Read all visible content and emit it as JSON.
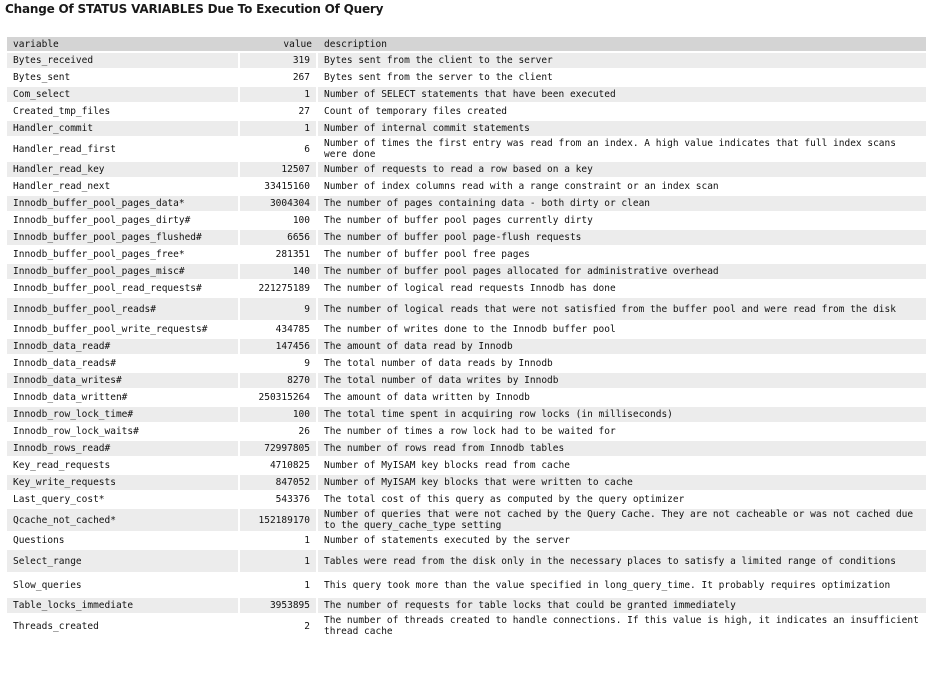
{
  "title": "Change Of STATUS VARIABLES Due To Execution Of Query",
  "columns": {
    "variable": "variable",
    "value": "value",
    "description": "description"
  },
  "rows": [
    {
      "variable": "Bytes_received",
      "value": "319",
      "description": "Bytes sent from the client to the server"
    },
    {
      "variable": "Bytes_sent",
      "value": "267",
      "description": "Bytes sent from the server to the client"
    },
    {
      "variable": "Com_select",
      "value": "1",
      "description": "Number of SELECT statements that have been executed"
    },
    {
      "variable": "Created_tmp_files",
      "value": "27",
      "description": "Count of temporary files created"
    },
    {
      "variable": "Handler_commit",
      "value": "1",
      "description": "Number of internal commit statements"
    },
    {
      "variable": "Handler_read_first",
      "value": "6",
      "description": "Number of times the first entry was read from an index. A high value indicates that full index scans were done"
    },
    {
      "variable": "Handler_read_key",
      "value": "12507",
      "description": "Number of requests to read a row based on a key"
    },
    {
      "variable": "Handler_read_next",
      "value": "33415160",
      "description": "Number of index columns read with a range constraint or an index scan"
    },
    {
      "variable": "Innodb_buffer_pool_pages_data*",
      "value": "3004304",
      "description": "The number of pages containing data - both dirty or clean"
    },
    {
      "variable": "Innodb_buffer_pool_pages_dirty#",
      "value": "100",
      "description": "The number of buffer pool pages currently dirty"
    },
    {
      "variable": "Innodb_buffer_pool_pages_flushed#",
      "value": "6656",
      "description": "The number of buffer pool page-flush requests"
    },
    {
      "variable": "Innodb_buffer_pool_pages_free*",
      "value": "281351",
      "description": "The number of buffer pool free pages"
    },
    {
      "variable": "Innodb_buffer_pool_pages_misc#",
      "value": "140",
      "description": "The number of buffer pool pages allocated for administrative overhead"
    },
    {
      "variable": "Innodb_buffer_pool_read_requests#",
      "value": "221275189",
      "description": "The number of logical read requests Innodb has done"
    },
    {
      "variable": "Innodb_buffer_pool_reads#",
      "value": "9",
      "description": "The number of logical reads that were not satisfied from the buffer pool and were read from the disk"
    },
    {
      "variable": "Innodb_buffer_pool_write_requests#",
      "value": "434785",
      "description": "The number of writes done to the Innodb buffer pool"
    },
    {
      "variable": "Innodb_data_read#",
      "value": "147456",
      "description": "The amount of data read by Innodb"
    },
    {
      "variable": "Innodb_data_reads#",
      "value": "9",
      "description": "The total number of data reads by Innodb"
    },
    {
      "variable": "Innodb_data_writes#",
      "value": "8270",
      "description": "The total number of data writes by Innodb"
    },
    {
      "variable": "Innodb_data_written#",
      "value": "250315264",
      "description": "The amount of data written by Innodb"
    },
    {
      "variable": "Innodb_row_lock_time#",
      "value": "100",
      "description": "The total time spent in acquiring row locks (in milliseconds)"
    },
    {
      "variable": "Innodb_row_lock_waits#",
      "value": "26",
      "description": "The number of times a row lock had to be waited for"
    },
    {
      "variable": "Innodb_rows_read#",
      "value": "72997805",
      "description": "The number of rows read from Innodb tables"
    },
    {
      "variable": "Key_read_requests",
      "value": "4710825",
      "description": "Number of MyISAM key blocks read from cache"
    },
    {
      "variable": "Key_write_requests",
      "value": "847052",
      "description": "Number of MyISAM key blocks that were written to cache"
    },
    {
      "variable": "Last_query_cost*",
      "value": "543376",
      "description": "The total cost of this query as computed by the query optimizer"
    },
    {
      "variable": "Qcache_not_cached*",
      "value": "152189170",
      "description": "Number of queries that were not cached by the Query Cache. They are not cacheable or was not cached due to the query_cache_type setting"
    },
    {
      "variable": "Questions",
      "value": "1",
      "description": "Number of statements executed by the server"
    },
    {
      "variable": "Select_range",
      "value": "1",
      "description": "Tables were read from the disk only in the necessary places to satisfy a limited range of conditions"
    },
    {
      "variable": "Slow_queries",
      "value": "1",
      "description": "This query took more than the value specified in long_query_time. It probably requires optimization"
    },
    {
      "variable": "Table_locks_immediate",
      "value": "3953895",
      "description": "The number of requests for table locks that could be granted immediately"
    },
    {
      "variable": "Threads_created",
      "value": "2",
      "description": "The number of threads created to handle connections. If this value is high, it indicates an insufficient thread cache"
    }
  ],
  "colors": {
    "header_bg": "#d4d4d4",
    "row_odd_bg": "#ececec",
    "row_even_bg": "#ffffff"
  }
}
